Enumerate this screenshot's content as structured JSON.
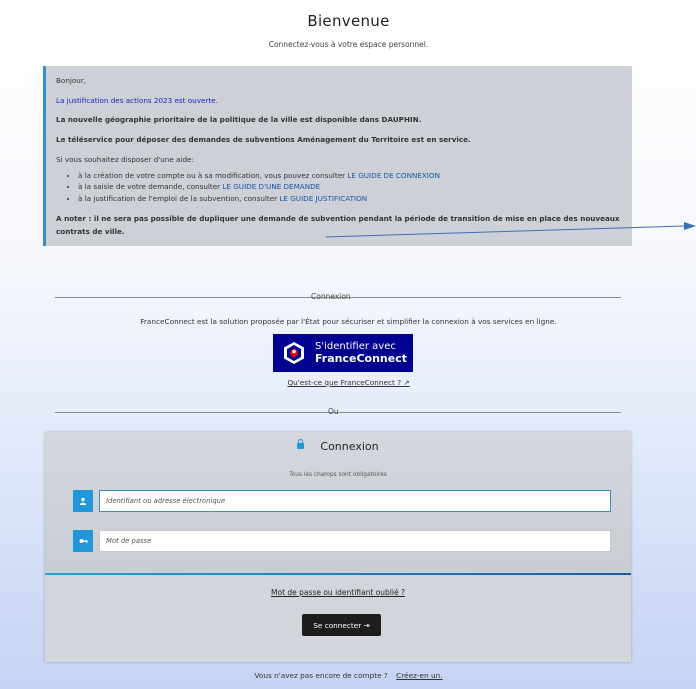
{
  "header": {
    "title": "Bienvenue",
    "subtitle": "Connectez-vous à votre espace personnel."
  },
  "info": {
    "greeting": "Bonjour,",
    "justification": "La justification des actions 2023 est ouverte.",
    "geographie": "La nouvelle géographie prioritaire de la politique de la ville est disponible dans DAUPHIN.",
    "teleservice": "Le téléservice pour déposer des demandes de subventions Aménagement du Territoire est en service.",
    "aide_intro": "Si vous souhaitez disposer d'une aide:",
    "items": [
      {
        "text": "à la création de votre compte ou à sa modification, vous pouvez consulter ",
        "link": "LE GUIDE DE CONNEXION"
      },
      {
        "text": "à la saisie de votre demande, consulter ",
        "link": "LE GUIDE D'UNE DEMANDE"
      },
      {
        "text": "à la justification de l'emploi de la subvention, consulter ",
        "link": "LE GUIDE JUSTIFICATION"
      }
    ],
    "note": "A noter : il ne sera pas possible de dupliquer une demande de subvention pendant la période de transition de mise en place des nouveaux contrats de ville."
  },
  "connexion_sep": "Connexion",
  "franceconnect": {
    "description": "FranceConnect est la solution proposée par l'État pour sécuriser et simplifier la connexion à vos services en ligne.",
    "button_line1": "S'identifier avec",
    "button_line2": "FranceConnect",
    "what_link": "Qu'est-ce que FranceConnect ?",
    "external_icon": "↗"
  },
  "ou_sep": "Ou",
  "login": {
    "title": "Connexion",
    "required": "Tous les champs sont obligatoires",
    "username_placeholder": "Identifiant ou adresse électronique",
    "password_placeholder": "Mot de passe",
    "forgot": "Mot de passe ou identifiant oublié ?",
    "submit": "Se connecter",
    "submit_icon": "⇥"
  },
  "footer": {
    "text": "Vous n'avez pas encore de compte ?",
    "link": "Créez-en un."
  },
  "colors": {
    "accent": "#2196d9",
    "fc_blue": "#000091",
    "info_bg": "#cdd0d6",
    "arrow": "#3a6fb5"
  },
  "icons": {
    "user": "user-icon",
    "key": "key-icon",
    "lock": "lock-icon"
  }
}
